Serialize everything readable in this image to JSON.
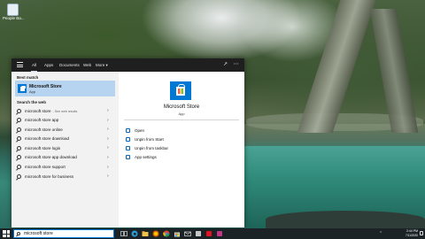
{
  "desktop": {
    "icon_label": "People Ba..."
  },
  "search_panel": {
    "tabs": [
      "Apps",
      "Documents",
      "Web",
      "More ▾"
    ],
    "tab_all": "All",
    "best_match_header": "Best match",
    "best_match": {
      "name": "Microsoft Store",
      "type": "App"
    },
    "search_web_header": "Search the web",
    "web_results": [
      {
        "query": "microsoft store",
        "hint": "- See web results"
      },
      {
        "query": "microsoft store app",
        "hint": ""
      },
      {
        "query": "microsoft store online",
        "hint": ""
      },
      {
        "query": "microsoft store download",
        "hint": ""
      },
      {
        "query": "microsoft store login",
        "hint": ""
      },
      {
        "query": "microsoft store app download",
        "hint": ""
      },
      {
        "query": "microsoft store support",
        "hint": ""
      },
      {
        "query": "microsoft store for business",
        "hint": ""
      }
    ],
    "detail": {
      "name": "Microsoft Store",
      "type": "App",
      "actions": [
        "Open",
        "Unpin from Start",
        "Unpin from taskbar",
        "App settings"
      ]
    }
  },
  "taskbar": {
    "search_value": "microsoft store",
    "time": "2:44 PM",
    "date": "7/11/2020"
  },
  "colors": {
    "accent": "#0078d4",
    "best_match_highlight": "#b6d3ef",
    "tabbar_bg": "#1f1f1f",
    "taskbar_bg": "#1c2326"
  },
  "icons": {
    "start": "windows-logo-icon",
    "search": "search-icon",
    "store": "store-bag-icon"
  }
}
